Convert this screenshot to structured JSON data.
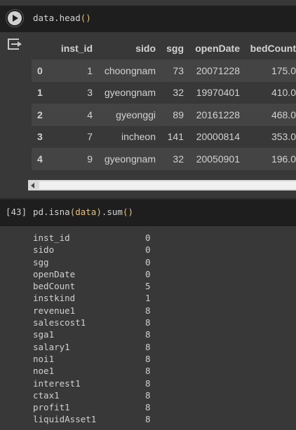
{
  "cell1": {
    "code": {
      "fn": "data.head",
      "args": "()"
    },
    "table": {
      "columns": [
        "inst_id",
        "sido",
        "sgg",
        "openDate",
        "bedCount"
      ],
      "rows": [
        {
          "index": "0",
          "inst_id": "1",
          "sido": "choongnam",
          "sgg": "73",
          "openDate": "20071228",
          "bedCount": "175.0"
        },
        {
          "index": "1",
          "inst_id": "3",
          "sido": "gyeongnam",
          "sgg": "32",
          "openDate": "19970401",
          "bedCount": "410.0"
        },
        {
          "index": "2",
          "inst_id": "4",
          "sido": "gyeonggi",
          "sgg": "89",
          "openDate": "20161228",
          "bedCount": "468.0"
        },
        {
          "index": "3",
          "inst_id": "7",
          "sido": "incheon",
          "sgg": "141",
          "openDate": "20000814",
          "bedCount": "353.0"
        },
        {
          "index": "4",
          "inst_id": "9",
          "sido": "gyeongnam",
          "sgg": "32",
          "openDate": "20050901",
          "bedCount": "196.0"
        }
      ]
    }
  },
  "cell2": {
    "prompt": "[43]",
    "code": {
      "a": "pd.isna",
      "b": "(data)",
      "c": ".sum",
      "d": "()"
    },
    "output": [
      {
        "k": "inst_id",
        "v": "0"
      },
      {
        "k": "sido",
        "v": "0"
      },
      {
        "k": "sgg",
        "v": "0"
      },
      {
        "k": "openDate",
        "v": "0"
      },
      {
        "k": "bedCount",
        "v": "5"
      },
      {
        "k": "instkind",
        "v": "1"
      },
      {
        "k": "revenue1",
        "v": "8"
      },
      {
        "k": "salescost1",
        "v": "8"
      },
      {
        "k": "sga1",
        "v": "8"
      },
      {
        "k": "salary1",
        "v": "8"
      },
      {
        "k": "noi1",
        "v": "8"
      },
      {
        "k": "noe1",
        "v": "8"
      },
      {
        "k": "interest1",
        "v": "8"
      },
      {
        "k": "ctax1",
        "v": "8"
      },
      {
        "k": "profit1",
        "v": "8"
      },
      {
        "k": "liquidAsset1",
        "v": "8"
      }
    ]
  },
  "icons": {
    "run": "play-icon",
    "output": "output-redirect-icon"
  },
  "colors": {
    "code_bg": "#1e1e1e",
    "output_bg": "#383838",
    "row_alt": "#444444",
    "paren": "#e6c07b"
  }
}
